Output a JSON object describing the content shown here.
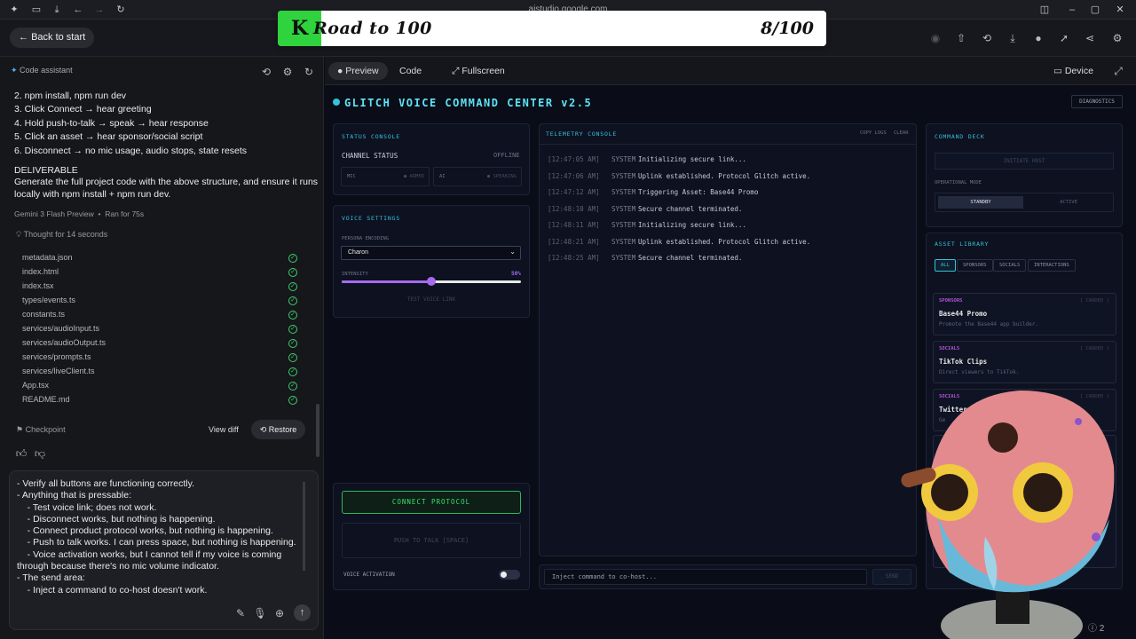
{
  "browser": {
    "address": "aistudio.google.com"
  },
  "banner": {
    "logo": "K",
    "title": "Road to 100",
    "count": "8/100"
  },
  "nav": {
    "back_label": "Back to start",
    "assistant_label": "Code assistant"
  },
  "steps": [
    "2. npm install, npm run dev",
    "3. Click Connect → hear greeting",
    "4. Hold push-to-talk → speak → hear response",
    "5. Click an asset → hear sponsor/social script",
    "6. Disconnect → no mic usage, audio stops, state resets"
  ],
  "deliverable": {
    "heading": "DELIVERABLE",
    "line1": "Generate the full project code with the above structure, and ensure it runs",
    "line2": "locally with npm install + npm run dev."
  },
  "run_meta": {
    "model": "Gemini 3 Flash Preview",
    "ran": "Ran for 75s",
    "thought": "Thought for 14 seconds"
  },
  "files": [
    "metadata.json",
    "index.html",
    "index.tsx",
    "types/events.ts",
    "constants.ts",
    "services/audioInput.ts",
    "services/audioOutput.ts",
    "services/prompts.ts",
    "services/liveClient.ts",
    "App.tsx",
    "README.md"
  ],
  "checkpoint": {
    "label": "Checkpoint",
    "view_diff": "View diff",
    "restore": "Restore"
  },
  "prompt_text": "- Verify all buttons are functioning correctly.\n- Anything that is pressable:\n    - Test voice link; does not work.\n    - Disconnect works, but nothing is happening.\n    - Connect product protocol works, but nothing is happening.\n    - Push to talk works. I can press space, but nothing is happening.\n    - Voice activation works, but I cannot tell if my voice is coming\nthrough because there's no mic volume indicator.\n- The send area:\n    - Inject a command to co-host doesn't work.",
  "tabs": {
    "preview": "Preview",
    "code": "Code",
    "fullscreen": "Fullscreen",
    "device": "Device"
  },
  "app": {
    "title": "GLITCH VOICE COMMAND CENTER v2.5",
    "diagnostics": "DIAGNOSTICS",
    "status": {
      "label": "STATUS CONSOLE",
      "channel": "CHANNEL STATUS",
      "state": "OFFLINE",
      "mic": "MIC",
      "mic_state": "● ARMED",
      "ai": "AI",
      "ai_state": "● SPEAKING"
    },
    "voice": {
      "label": "VOICE SETTINGS",
      "persona_label": "PERSONA ENCODING",
      "persona": "Charon",
      "intensity_label": "INTENSITY",
      "intensity_value": "50%",
      "intensity": 0.5,
      "test": "TEST VOICE LINK"
    },
    "connect": "CONNECT PROTOCOL",
    "ptt": "PUSH TO TALK [SPACE]",
    "voice_activation": "VOICE ACTIVATION",
    "telemetry": {
      "label": "TELEMETRY CONSOLE",
      "copy": "COPY LOGS",
      "clear": "CLEAR",
      "logs": [
        {
          "ts": "[12:47:05 AM]",
          "src": "SYSTEM",
          "msg": "Initializing secure link..."
        },
        {
          "ts": "[12:47:06 AM]",
          "src": "SYSTEM",
          "msg": "Uplink established. Protocol Glitch active."
        },
        {
          "ts": "[12:47:12 AM]",
          "src": "SYSTEM",
          "msg": "Triggering Asset: Base44 Promo"
        },
        {
          "ts": "[12:48:10 AM]",
          "src": "SYSTEM",
          "msg": "Secure channel terminated."
        },
        {
          "ts": "[12:48:11 AM]",
          "src": "SYSTEM",
          "msg": "Initializing secure link..."
        },
        {
          "ts": "[12:48:21 AM]",
          "src": "SYSTEM",
          "msg": "Uplink established. Protocol Glitch active."
        },
        {
          "ts": "[12:48:25 AM]",
          "src": "SYSTEM",
          "msg": "Secure channel terminated."
        }
      ]
    },
    "inject_placeholder": "Inject command to co-host...",
    "send": "SEND",
    "deck": {
      "label": "COMMAND DECK",
      "initiate": "INITIATE HOST",
      "mode_label": "OPERATIONAL MODE",
      "standby": "STANDBY",
      "active": "ACTIVE"
    },
    "library": {
      "label": "ASSET LIBRARY",
      "filters": [
        "ALL",
        "SPONSORS",
        "SOCIALS",
        "INTERACTIONS"
      ],
      "assets": [
        {
          "cat": "SPONSORS",
          "name": "Base44 Promo",
          "desc": "Promote the Base44 app builder.",
          "count": "[ CARDED ]"
        },
        {
          "cat": "SOCIALS",
          "name": "TikTok Clips",
          "desc": "Direct viewers to TikTok.",
          "count": "[ CARDED ]"
        },
        {
          "cat": "SOCIALS",
          "name": "Twitter",
          "desc": "Ge",
          "count": "[ CARDED ]"
        }
      ]
    }
  },
  "footer": {
    "issues": "2"
  },
  "colors": {
    "accent": "#5fe3f7",
    "green": "#3ae06a",
    "purple": "#a56bf0"
  }
}
